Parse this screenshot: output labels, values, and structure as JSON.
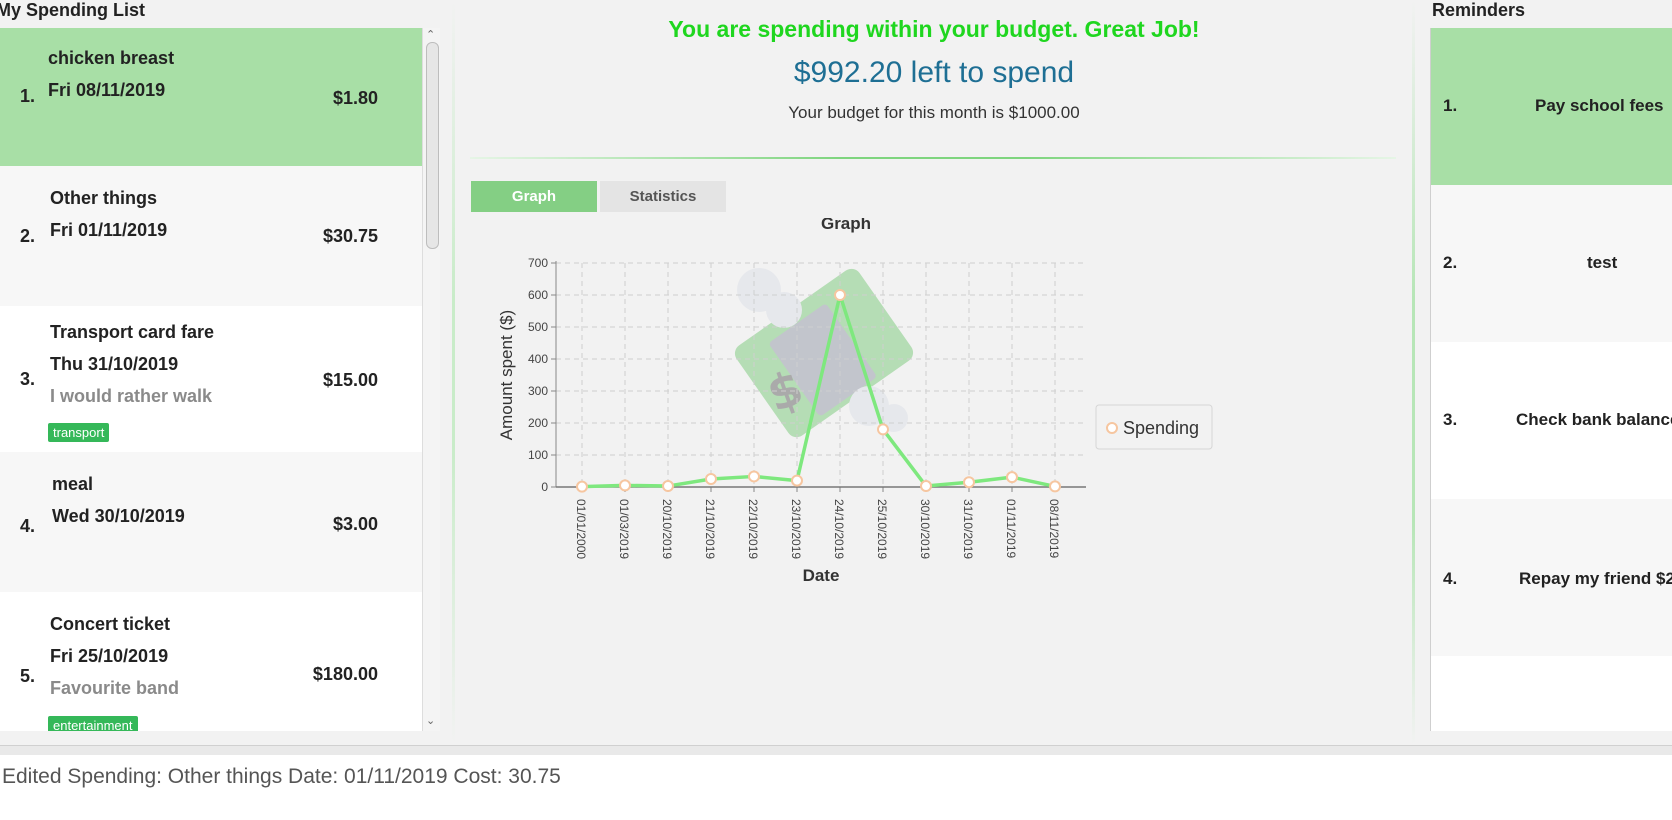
{
  "spending_list": {
    "title": "My Spending List",
    "items": [
      {
        "index": "1.",
        "description": "chicken breast",
        "date": "Fri 08/11/2019",
        "amount": "$1.80",
        "remark": "",
        "tag": ""
      },
      {
        "index": "2.",
        "description": "Other things",
        "date": "Fri 01/11/2019",
        "amount": "$30.75",
        "remark": "",
        "tag": ""
      },
      {
        "index": "3.",
        "description": "Transport card fare",
        "date": "Thu 31/10/2019",
        "amount": "$15.00",
        "remark": "I would rather walk",
        "tag": "transport"
      },
      {
        "index": "4.",
        "description": "meal",
        "date": "Wed 30/10/2019",
        "amount": "$3.00",
        "remark": "",
        "tag": ""
      },
      {
        "index": "5.",
        "description": "Concert ticket",
        "date": "Fri 25/10/2019",
        "amount": "$180.00",
        "remark": "Favourite band",
        "tag": "entertainment"
      }
    ]
  },
  "budget": {
    "message": "You are spending within your budget. Great Job!",
    "left_to_spend": "$992.20 left to spend",
    "monthly_budget": "Your budget for this month is $1000.00"
  },
  "tabs": [
    {
      "label": "Graph",
      "selected": true
    },
    {
      "label": "Statistics",
      "selected": false
    }
  ],
  "chart_data": {
    "type": "line",
    "title": "Graph",
    "xlabel": "Date",
    "ylabel": "Amount spent ($)",
    "categories": [
      "01/01/2000",
      "01/03/2019",
      "20/10/2019",
      "21/10/2019",
      "22/10/2019",
      "23/10/2019",
      "24/10/2019",
      "25/10/2019",
      "30/10/2019",
      "31/10/2019",
      "01/11/2019",
      "08/11/2019"
    ],
    "series": [
      {
        "name": "Spending",
        "values": [
          1,
          5,
          3,
          25,
          33,
          20,
          600,
          180,
          3,
          15,
          30.75,
          1.8
        ]
      }
    ],
    "ylim": [
      0,
      700
    ],
    "yticks": [
      0,
      100,
      200,
      300,
      400,
      500,
      600,
      700
    ],
    "grid": true,
    "legend": "right",
    "line_color": "#7ee87e",
    "marker_color": "#f6c6a0"
  },
  "reminders": {
    "title": "Reminders",
    "items": [
      {
        "index": "1.",
        "text": "Pay school fees"
      },
      {
        "index": "2.",
        "text": "test"
      },
      {
        "index": "3.",
        "text": "Check bank balance"
      },
      {
        "index": "4.",
        "text": "Repay my friend $2"
      }
    ]
  },
  "result_display": "Edited Spending: Other things Date: 01/11/2019 Cost: 30.75",
  "colors": {
    "selected_card": "#a8dfa6",
    "card_alt": "#f7f7f7",
    "card": "#ffffff",
    "accent_green": "#1fd61f",
    "accent_blue": "#1e6f94",
    "tag_green": "#35b859"
  }
}
